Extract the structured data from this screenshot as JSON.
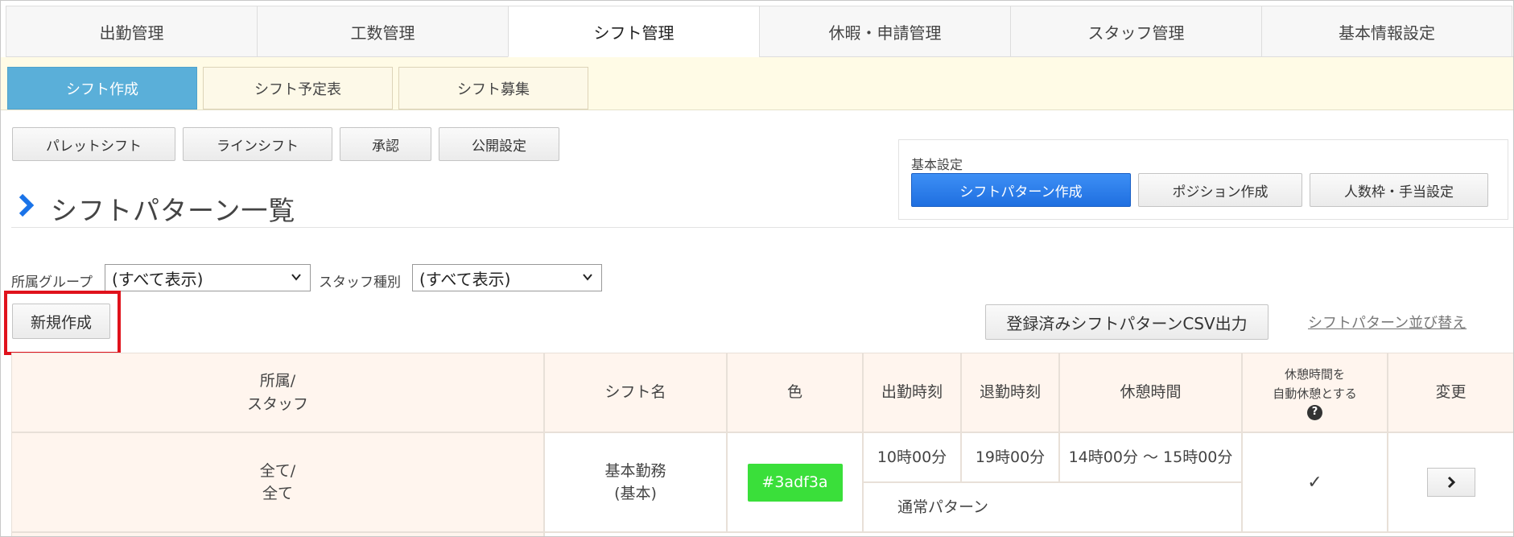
{
  "top_nav": [
    {
      "label": "出勤管理",
      "active": false
    },
    {
      "label": "工数管理",
      "active": false
    },
    {
      "label": "シフト管理",
      "active": true
    },
    {
      "label": "休暇・申請管理",
      "active": false
    },
    {
      "label": "スタッフ管理",
      "active": false
    },
    {
      "label": "基本情報設定",
      "active": false
    }
  ],
  "sub_nav": [
    {
      "label": "シフト作成",
      "active": true
    },
    {
      "label": "シフト予定表",
      "active": false
    },
    {
      "label": "シフト募集",
      "active": false
    }
  ],
  "toolbar": {
    "palette_shift": "パレットシフト",
    "line_shift": "ラインシフト",
    "approval": "承認",
    "publish_settings": "公開設定"
  },
  "basic_settings": {
    "label": "基本設定",
    "shift_pattern_create": "シフトパターン作成",
    "position_create": "ポジション作成",
    "headcount_allowance": "人数枠・手当設定"
  },
  "page_title": "シフトパターン一覧",
  "filters": {
    "group_label": "所属グループ",
    "group_value": "(すべて表示)",
    "staff_type_label": "スタッフ種別",
    "staff_type_value": "(すべて表示)"
  },
  "actions": {
    "new_create": "新規作成",
    "csv_export": "登録済みシフトパターンCSV出力",
    "reorder": "シフトパターン並び替え"
  },
  "table": {
    "headers": {
      "group_staff_line1": "所属/",
      "group_staff_line2": "スタッフ",
      "shift_name": "シフト名",
      "color": "色",
      "start_time": "出勤時刻",
      "end_time": "退勤時刻",
      "break_time": "休憩時間",
      "auto_break_line1": "休憩時間を",
      "auto_break_line2": "自動休憩とする",
      "change": "変更"
    },
    "rows": [
      {
        "group_line1": "全て/",
        "group_line2": "全て",
        "shift_name_line1": "基本勤務",
        "shift_name_line2": "(基本)",
        "color": "#3adf3a",
        "start": "10時00分",
        "end": "19時00分",
        "break": "14時00分 〜 15時00分",
        "pattern_type": "通常パターン",
        "auto_break": "✓"
      }
    ]
  },
  "icons": {
    "title_chevron": "chevron-right-icon",
    "select_chevron": "chevron-down-icon",
    "help": "question-circle-icon",
    "row_arrow": "chevron-right-icon"
  },
  "colors": {
    "accent_blue": "#1f6fe0",
    "subnav_active": "#5aafd9",
    "title_chevron": "#1a73e8",
    "highlight_red": "#e0121c"
  }
}
